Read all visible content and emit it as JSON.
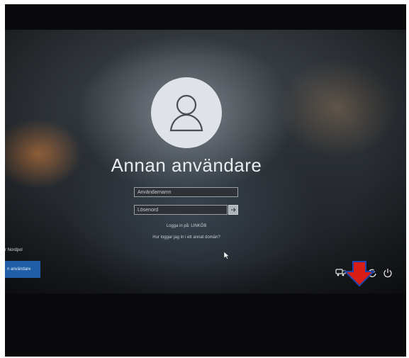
{
  "login": {
    "username": "Annan användare",
    "username_field_value": "Användarnamn",
    "password_field_value": "Lösenord",
    "sign_in_to_label": "Logga in på: LINKÖB",
    "forgot_link": "Hur loggar jag in i ett annat domän?"
  },
  "left_panel": {
    "label": "r Nordpol",
    "button_label": "n användare"
  },
  "tray": {
    "icons": [
      "accessibility-icon",
      "network-icon",
      "ease-of-access-icon",
      "power-icon"
    ]
  },
  "annotation": {
    "color": "#d91e18",
    "outline_color": "#2244aa"
  },
  "colors": {
    "accent": "#1e5fa8",
    "avatar_bg": "#dfe3e8"
  }
}
